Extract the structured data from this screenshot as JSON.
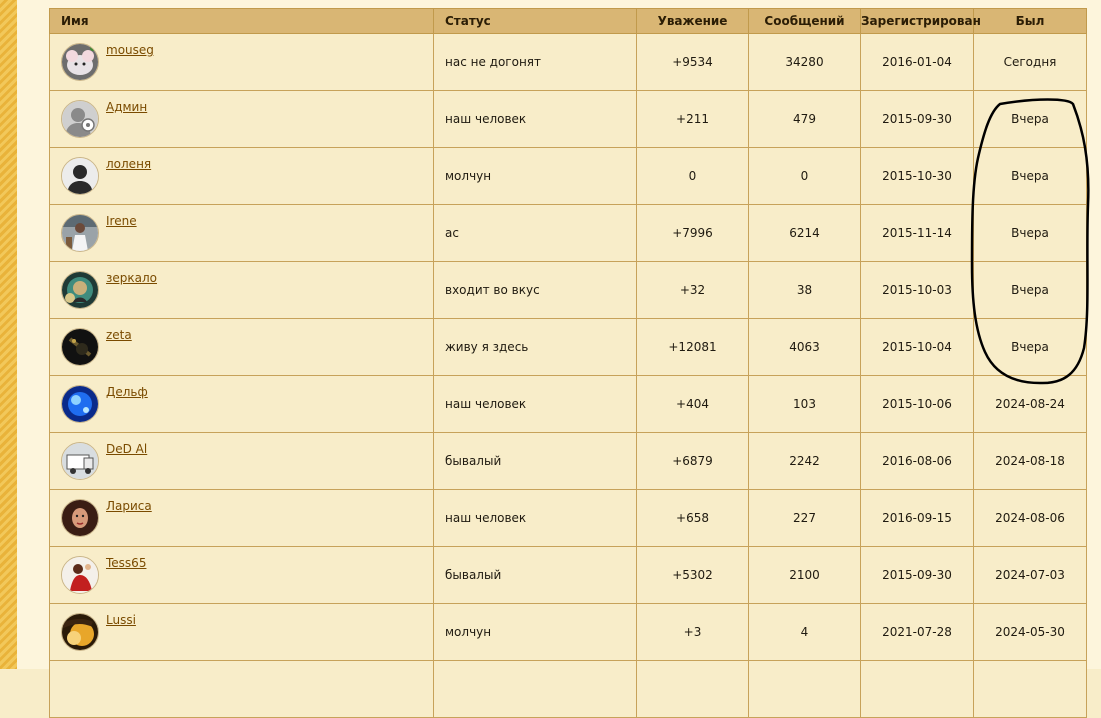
{
  "table": {
    "headers": {
      "name": "Имя",
      "status": "Статус",
      "respect": "Уважение",
      "posts": "Сообщений",
      "registered": "Зарегистрирован",
      "last_seen": "Был"
    },
    "rows": [
      {
        "name": "mouseg",
        "status": "нас не догонят",
        "respect": "+9534",
        "posts": "34280",
        "registered": "2016-01-04",
        "last_seen": "Сегодня"
      },
      {
        "name": "Админ",
        "status": "наш человек",
        "respect": "+211",
        "posts": "479",
        "registered": "2015-09-30",
        "last_seen": "Вчера"
      },
      {
        "name": "лоленя",
        "status": "молчун",
        "respect": "0",
        "posts": "0",
        "registered": "2015-10-30",
        "last_seen": "Вчера"
      },
      {
        "name": "Irene",
        "status": "ас",
        "respect": "+7996",
        "posts": "6214",
        "registered": "2015-11-14",
        "last_seen": "Вчера"
      },
      {
        "name": "зеркало",
        "status": "входит во вкус",
        "respect": "+32",
        "posts": "38",
        "registered": "2015-10-03",
        "last_seen": "Вчера"
      },
      {
        "name": "zeta",
        "status": "живу я здесь",
        "respect": "+12081",
        "posts": "4063",
        "registered": "2015-10-04",
        "last_seen": "Вчера"
      },
      {
        "name": "Дельф",
        "status": "наш человек",
        "respect": "+404",
        "posts": "103",
        "registered": "2015-10-06",
        "last_seen": "2024-08-24"
      },
      {
        "name": "DeD Al",
        "status": "бывалый",
        "respect": "+6879",
        "posts": "2242",
        "registered": "2016-08-06",
        "last_seen": "2024-08-18"
      },
      {
        "name": "Лариса",
        "status": "наш человек",
        "respect": "+658",
        "posts": "227",
        "registered": "2016-09-15",
        "last_seen": "2024-08-06"
      },
      {
        "name": "Tess65",
        "status": "бывалый",
        "respect": "+5302",
        "posts": "2100",
        "registered": "2015-09-30",
        "last_seen": "2024-07-03"
      },
      {
        "name": "Lussi",
        "status": "молчун",
        "respect": "+3",
        "posts": "4",
        "registered": "2021-07-28",
        "last_seen": "2024-05-30"
      }
    ]
  },
  "colors": {
    "header_bg": "#d9b674",
    "row_bg": "#f8edc9",
    "link": "#7a4b00",
    "border": "#c7a25a"
  }
}
